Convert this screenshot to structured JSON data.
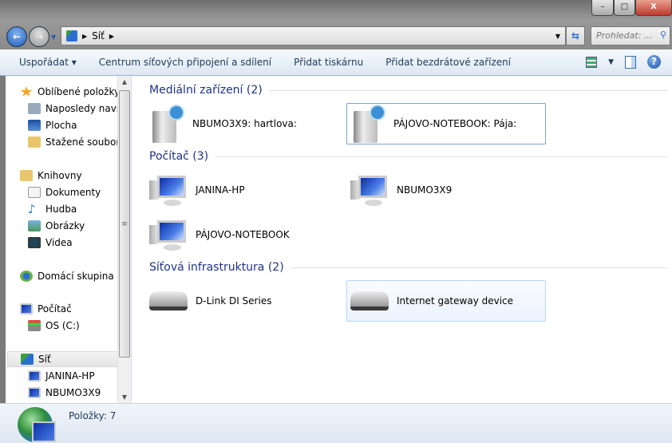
{
  "window": {
    "minimize": "–",
    "maximize": "□",
    "close": "X"
  },
  "address": {
    "path": [
      "Síť"
    ],
    "search_placeholder": "Prohledat: ..."
  },
  "toolbar": {
    "organize": "Uspořádat ▾",
    "network_center": "Centrum síťových připojení a sdílení",
    "add_printer": "Přidat tiskárnu",
    "add_wireless": "Přidat bezdrátové zařízení",
    "help": "?"
  },
  "sidebar": {
    "favorites": "Oblíbené položky",
    "recent": "Naposledy navštívená místa",
    "desktop": "Plocha",
    "downloads": "Stažené soubory",
    "libraries": "Knihovny",
    "documents": "Dokumenty",
    "music": "Hudba",
    "pictures": "Obrázky",
    "videos": "Videa",
    "homegroup": "Domácí skupina",
    "computer": "Počítač",
    "drive_c": "OS (C:)",
    "network": "Síť",
    "net_items": [
      "JANINA-HP",
      "NBUMO3X9"
    ]
  },
  "groups": [
    {
      "title": "Mediální zařízení (2)",
      "items": [
        "NBUMO3X9: hartlova:",
        "PÁJOVO-NOTEBOOK: Pája:"
      ]
    },
    {
      "title": "Počítač (3)",
      "items": [
        "JANINA-HP",
        "NBUMO3X9",
        "PÁJOVO-NOTEBOOK"
      ]
    },
    {
      "title": "Síťová infrastruktura (2)",
      "items": [
        "D-Link DI Series",
        "Internet gateway device"
      ]
    }
  ],
  "status": {
    "count": "Položky: 7"
  }
}
